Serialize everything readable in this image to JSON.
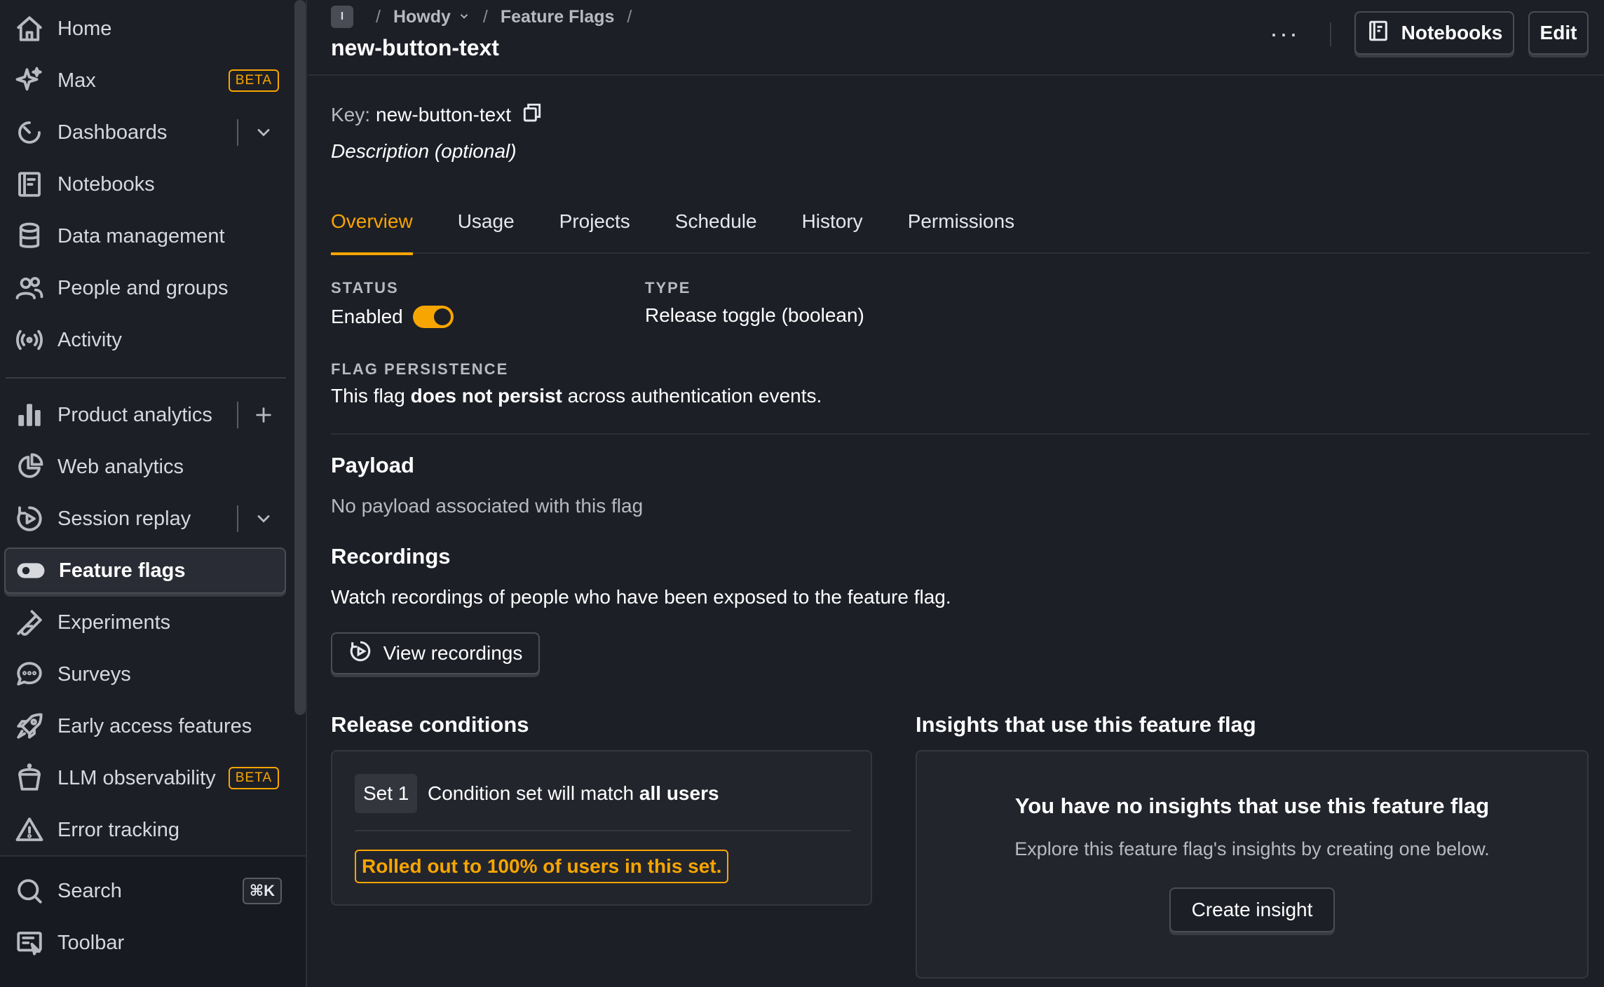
{
  "sidebar": {
    "items": [
      {
        "label": "Home",
        "icon": "home-icon"
      },
      {
        "label": "Max",
        "icon": "sparkle-icon",
        "badge": "BETA"
      },
      {
        "label": "Dashboards",
        "icon": "dashboard-icon"
      },
      {
        "label": "Notebooks",
        "icon": "notebook-icon"
      },
      {
        "label": "Data management",
        "icon": "database-icon"
      },
      {
        "label": "People and groups",
        "icon": "people-icon"
      },
      {
        "label": "Activity",
        "icon": "broadcast-icon"
      },
      {
        "label": "Product analytics",
        "icon": "bar-chart-icon"
      },
      {
        "label": "Web analytics",
        "icon": "pie-chart-icon"
      },
      {
        "label": "Session replay",
        "icon": "replay-icon"
      },
      {
        "label": "Feature flags",
        "icon": "toggle-icon"
      },
      {
        "label": "Experiments",
        "icon": "flask-icon"
      },
      {
        "label": "Surveys",
        "icon": "chat-icon"
      },
      {
        "label": "Early access features",
        "icon": "rocket-icon"
      },
      {
        "label": "LLM observability",
        "icon": "llm-icon",
        "badge": "BETA"
      },
      {
        "label": "Error tracking",
        "icon": "warning-icon"
      }
    ],
    "bottom": [
      {
        "label": "Search",
        "icon": "search-icon",
        "shortcut": "⌘K"
      },
      {
        "label": "Toolbar",
        "icon": "toolbar-icon"
      }
    ]
  },
  "header": {
    "crumb_badge": "I",
    "crumb_project": "Howdy",
    "crumb_section": "Feature Flags",
    "title": "new-button-text",
    "more": "···",
    "notebooks_label": "Notebooks",
    "edit_label": "Edit"
  },
  "flag": {
    "key_label": "Key:",
    "key_value": "new-button-text",
    "description_placeholder": "Description (optional)"
  },
  "tabs": [
    "Overview",
    "Usage",
    "Projects",
    "Schedule",
    "History",
    "Permissions"
  ],
  "overview": {
    "status_label": "STATUS",
    "status_value": "Enabled",
    "type_label": "TYPE",
    "type_value": "Release toggle (boolean)",
    "persistence_label": "FLAG PERSISTENCE",
    "persistence_pre": "This flag ",
    "persistence_bold": "does not persist",
    "persistence_post": " across authentication events.",
    "payload_title": "Payload",
    "payload_text": "No payload associated with this flag",
    "recordings_title": "Recordings",
    "recordings_text": "Watch recordings of people who have been exposed to the feature flag.",
    "view_recordings_label": "View recordings",
    "release_title": "Release conditions",
    "set_label": "Set 1",
    "condition_pre": "Condition set will match ",
    "condition_bold": "all users",
    "rollout_text": "Rolled out to 100% of users in this set.",
    "insights_title": "Insights that use this feature flag",
    "insights_empty_title": "You have no insights that use this feature flag",
    "insights_empty_text": "Explore this feature flag's insights by creating one below.",
    "create_insight_label": "Create insight"
  },
  "colors": {
    "accent": "#f7a501",
    "background": "#1d1f27",
    "panel": "#23252d"
  }
}
